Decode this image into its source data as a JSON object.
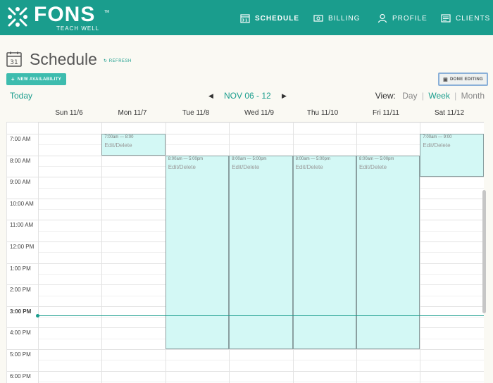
{
  "brand": {
    "name": "FONS",
    "tagline": "TEACH WELL",
    "tm": "TM"
  },
  "nav": [
    {
      "label": "SCHEDULE",
      "icon": "calendar-icon",
      "active": true
    },
    {
      "label": "BILLING",
      "icon": "billing-icon",
      "active": false
    },
    {
      "label": "PROFILE",
      "icon": "user-icon",
      "active": false
    },
    {
      "label": "CLIENTS",
      "icon": "clients-icon",
      "active": false
    }
  ],
  "page": {
    "title": "Schedule",
    "calendar_day": "31",
    "refresh": "REFRESH"
  },
  "actions": {
    "new_availability": "NEW AVAILABILITY",
    "new_plus": "+",
    "done_editing": "DONE EDITING"
  },
  "toolbar": {
    "today": "Today",
    "prev": "◀",
    "next": "▶",
    "range": "NOV 06 - 12",
    "view_label": "View:",
    "views": [
      "Day",
      "Week",
      "Month"
    ],
    "active_view": "Week",
    "sep": "|"
  },
  "days": [
    "Sun 11/6",
    "Mon 11/7",
    "Tue 11/8",
    "Wed 11/9",
    "Thu 11/10",
    "Fri 11/11",
    "Sat 11/12"
  ],
  "times": [
    "7:00 AM",
    "8:00 AM",
    "9:00 AM",
    "10:00 AM",
    "11:00 AM",
    "12:00 PM",
    "1:00 PM",
    "2:00 PM",
    "3:00 PM",
    "4:00 PM",
    "5:00 PM",
    "6:00 PM"
  ],
  "current_time_label": "3:00 PM",
  "events": [
    {
      "day": 1,
      "start": 7,
      "end": 8,
      "time_text": "7:00am — 8:00",
      "action": "Edit/Delete"
    },
    {
      "day": 2,
      "start": 8,
      "end": 17,
      "time_text": "8:00am — 5:00pm",
      "action": "Edit/Delete"
    },
    {
      "day": 3,
      "start": 8,
      "end": 17,
      "time_text": "8:00am — 5:00pm",
      "action": "Edit/Delete"
    },
    {
      "day": 4,
      "start": 8,
      "end": 17,
      "time_text": "8:00am — 5:00pm",
      "action": "Edit/Delete"
    },
    {
      "day": 5,
      "start": 8,
      "end": 17,
      "time_text": "8:00am — 5:00pm",
      "action": "Edit/Delete"
    },
    {
      "day": 6,
      "start": 7,
      "end": 9,
      "time_text": "7:00am — 9:00",
      "action": "Edit/Delete"
    }
  ],
  "colors": {
    "brand": "#1a9d8d",
    "event_fill": "#d3f8f5",
    "button": "#3dbcae"
  }
}
